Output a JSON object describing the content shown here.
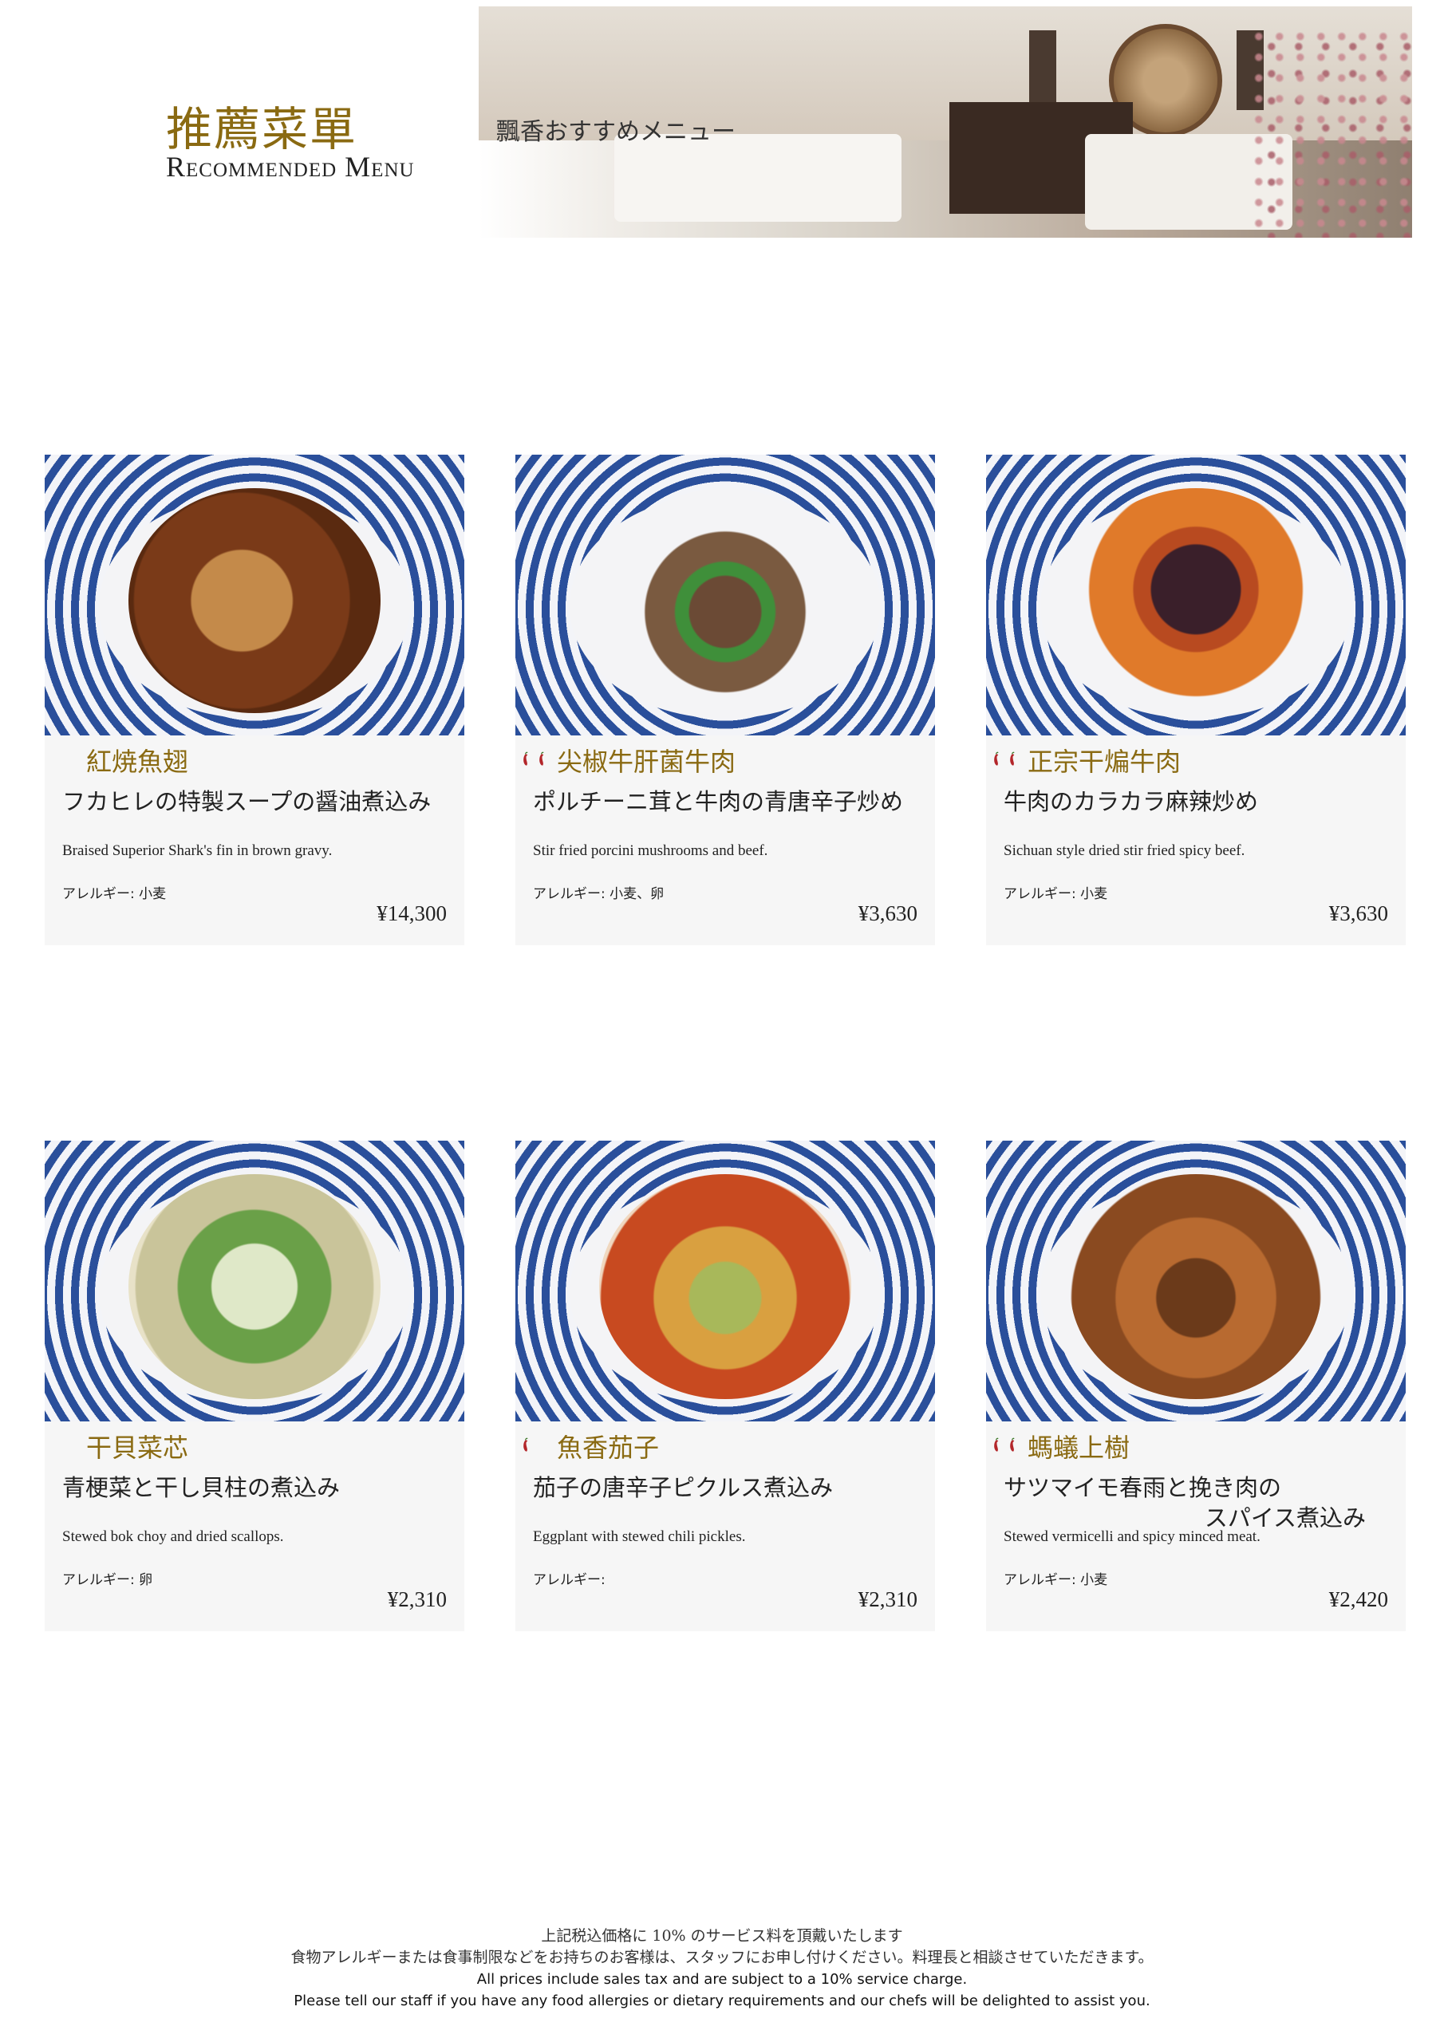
{
  "header": {
    "title_cn": "推薦菜單",
    "title_en": "Recommended Menu",
    "subtitle_jp": "飄香おすすめメニュー"
  },
  "dishes": [
    {
      "name_cn": "紅焼魚翅",
      "name_jp": "フカヒレの特製スープの醤油煮込み",
      "name_jp_line2": "",
      "name_en": "Braised Superior Shark's fin in brown gravy.",
      "allergy": "アレルギー: 小麦",
      "price": "¥14,300",
      "spice_level": 0
    },
    {
      "name_cn": "尖椒牛肝菌牛肉",
      "name_jp": "ポルチーニ茸と牛肉の青唐辛子炒め",
      "name_jp_line2": "",
      "name_en": "Stir fried porcini mushrooms and beef.",
      "allergy": "アレルギー: 小麦、卵",
      "price": "¥3,630",
      "spice_level": 2
    },
    {
      "name_cn": "正宗干煸牛肉",
      "name_jp": "牛肉のカラカラ麻辣炒め",
      "name_jp_line2": "",
      "name_en": "Sichuan style dried stir fried spicy beef.",
      "allergy": "アレルギー: 小麦",
      "price": "¥3,630",
      "spice_level": 2
    },
    {
      "name_cn": "干貝菜芯",
      "name_jp": "青梗菜と干し貝柱の煮込み",
      "name_jp_line2": "",
      "name_en": "Stewed bok choy and dried scallops.",
      "allergy": "アレルギー: 卵",
      "price": "¥2,310",
      "spice_level": 0
    },
    {
      "name_cn": "魚香茄子",
      "name_jp": "茄子の唐辛子ピクルス煮込み",
      "name_jp_line2": "",
      "name_en": "Eggplant with stewed chili pickles.",
      "allergy": "アレルギー:",
      "price": "¥2,310",
      "spice_level": 1
    },
    {
      "name_cn": "螞蟻上樹",
      "name_jp": "サツマイモ春雨と挽き肉の",
      "name_jp_line2": "スパイス煮込み",
      "name_en": "Stewed vermicelli and spicy minced meat.",
      "allergy": "アレルギー: 小麦",
      "price": "¥2,420",
      "spice_level": 2
    }
  ],
  "footer": {
    "line1": "上記税込価格に 10% のサービス料を頂戴いたします",
    "line2": "食物アレルギーまたは食事制限などをお持ちのお客様は、スタッフにお申し付けください。料理長と相談させていただきます。",
    "line3": "All prices include sales tax and are subject to a 10% service charge.",
    "line4": "Please tell our staff if you have any food allergies or dietary requirements and our chefs will be delighted to assist you."
  },
  "colors": {
    "accent_gold": "#8a6a12",
    "chili_red": "#b3262a",
    "card_bg": "#f6f6f6",
    "plate_blue": "#2a4f9b"
  },
  "icons": {
    "spice": "chili-pepper-icon"
  }
}
